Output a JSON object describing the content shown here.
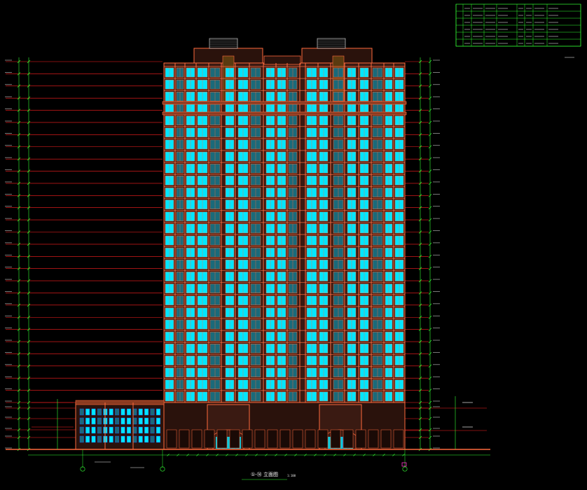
{
  "drawing": {
    "background_color": "#000000",
    "colors": {
      "facade": "#ff6a3d",
      "window": "#00e6ff",
      "level_line": "#ff2020",
      "dimension": "#33ff33",
      "white": "#ffffff",
      "yellow": "#ffff00",
      "magenta": "#ff33cc"
    },
    "title_block": {
      "rows": [
        [
          "",
          "",
          "",
          "",
          "",
          ""
        ],
        [
          "",
          "",
          "",
          "",
          "",
          ""
        ],
        [
          "",
          "",
          "",
          "",
          "",
          ""
        ],
        [
          "",
          "",
          "",
          "",
          "",
          ""
        ],
        [
          "",
          "",
          "",
          "",
          "",
          ""
        ]
      ]
    },
    "left_levels": [],
    "right_levels": [],
    "drawing_title": "①-⑭ 立面图",
    "scale_note": "1:100",
    "storeys": 28
  }
}
